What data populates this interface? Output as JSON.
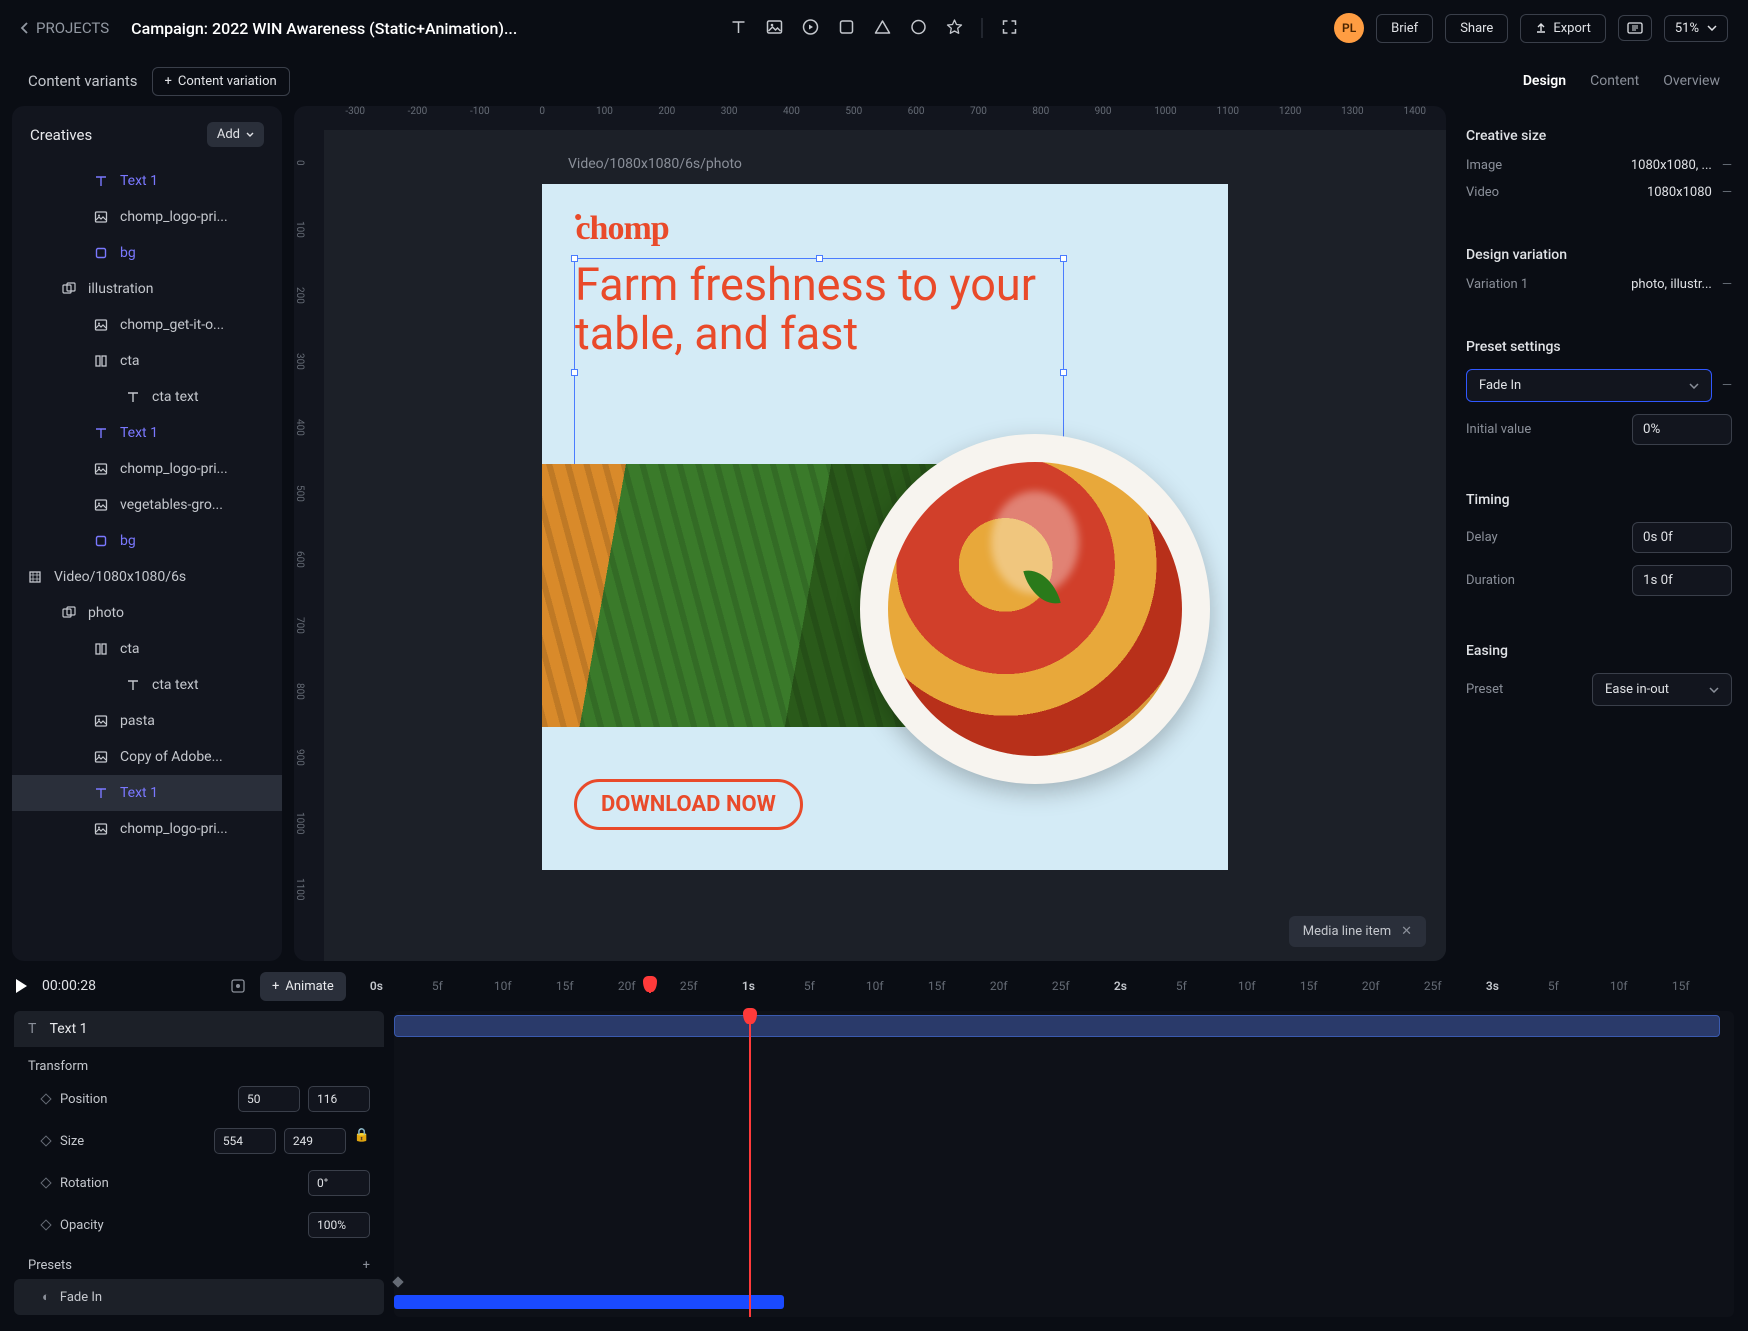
{
  "header": {
    "back_label": "PROJECTS",
    "title": "Campaign: 2022 WIN Awareness (Static+Animation)...",
    "avatar": "PL",
    "brief": "Brief",
    "share": "Share",
    "export": "Export",
    "zoom": "51%"
  },
  "secondbar": {
    "label": "Content variants",
    "add_btn": "Content variation",
    "tabs": {
      "design": "Design",
      "content": "Content",
      "overview": "Overview"
    }
  },
  "sidebar": {
    "title": "Creatives",
    "add": "Add",
    "items": [
      {
        "ico": "T",
        "label": "Text 1",
        "cls": "indent2 purple"
      },
      {
        "ico": "img",
        "label": "chomp_logo-pri...",
        "cls": "indent2"
      },
      {
        "ico": "sq",
        "label": "bg",
        "cls": "indent2 purple"
      },
      {
        "ico": "grp",
        "label": "illustration",
        "cls": "indent1"
      },
      {
        "ico": "img",
        "label": "chomp_get-it-o...",
        "cls": "indent2"
      },
      {
        "ico": "col",
        "label": "cta",
        "cls": "indent2"
      },
      {
        "ico": "T",
        "label": "cta text",
        "cls": "indent3"
      },
      {
        "ico": "T",
        "label": "Text 1",
        "cls": "indent2 purple"
      },
      {
        "ico": "img",
        "label": "chomp_logo-pri...",
        "cls": "indent2"
      },
      {
        "ico": "img",
        "label": "vegetables-gro...",
        "cls": "indent2"
      },
      {
        "ico": "sq",
        "label": "bg",
        "cls": "indent2 purple"
      },
      {
        "ico": "vid",
        "label": "Video/1080x1080/6s",
        "cls": ""
      },
      {
        "ico": "grp",
        "label": "photo",
        "cls": "indent1"
      },
      {
        "ico": "col",
        "label": "cta",
        "cls": "indent2"
      },
      {
        "ico": "T",
        "label": "cta text",
        "cls": "indent3"
      },
      {
        "ico": "img",
        "label": "pasta",
        "cls": "indent2"
      },
      {
        "ico": "img",
        "label": "Copy of Adobe...",
        "cls": "indent2"
      },
      {
        "ico": "T",
        "label": "Text 1",
        "cls": "indent2 purple selected"
      },
      {
        "ico": "img",
        "label": "chomp_logo-pri...",
        "cls": "indent2"
      }
    ]
  },
  "canvas": {
    "label": "Video/1080x1080/6s/photo",
    "logo": "chomp",
    "headline": "Farm freshness to your table, and fast",
    "cta": "DOWNLOAD NOW",
    "media_pill": "Media line item",
    "ruler_h": [
      "-300",
      "-200",
      "-100",
      "0",
      "100",
      "200",
      "300",
      "400",
      "500",
      "600",
      "700",
      "800",
      "900",
      "1000",
      "1100",
      "1200",
      "1300",
      "1400"
    ],
    "ruler_v": [
      "0",
      "100",
      "200",
      "300",
      "400",
      "500",
      "600",
      "700",
      "800",
      "900",
      "1000",
      "1100"
    ]
  },
  "right": {
    "size_title": "Creative size",
    "image_label": "Image",
    "image_val": "1080x1080, ...",
    "video_label": "Video",
    "video_val": "1080x1080",
    "variation_title": "Design variation",
    "var_label": "Variation 1",
    "var_val": "photo, illustr...",
    "preset_title": "Preset settings",
    "preset_select": "Fade In",
    "initial_label": "Initial value",
    "initial_val": "0%",
    "timing_title": "Timing",
    "delay_label": "Delay",
    "delay_val": "0s 0f",
    "duration_label": "Duration",
    "duration_val": "1s 0f",
    "easing_title": "Easing",
    "easing_label": "Preset",
    "easing_val": "Ease in-out"
  },
  "timeline": {
    "time": "00:00:28",
    "animate": "Animate",
    "ticks": [
      "0s",
      "5f",
      "10f",
      "15f",
      "20f",
      "25f",
      "1s",
      "5f",
      "10f",
      "15f",
      "20f",
      "25f",
      "2s",
      "5f",
      "10f",
      "15f",
      "20f",
      "25f",
      "3s",
      "5f",
      "10f",
      "15f"
    ],
    "majors": [
      "0s",
      "1s",
      "2s",
      "3s"
    ],
    "layer": "Text 1",
    "transform_label": "Transform",
    "position_label": "Position",
    "pos_x": "50",
    "pos_y": "116",
    "size_label": "Size",
    "size_w": "554",
    "size_h": "249",
    "rotation_label": "Rotation",
    "rotation": "0°",
    "opacity_label": "Opacity",
    "opacity": "100%",
    "presets_label": "Presets",
    "fadein": "Fade In"
  }
}
